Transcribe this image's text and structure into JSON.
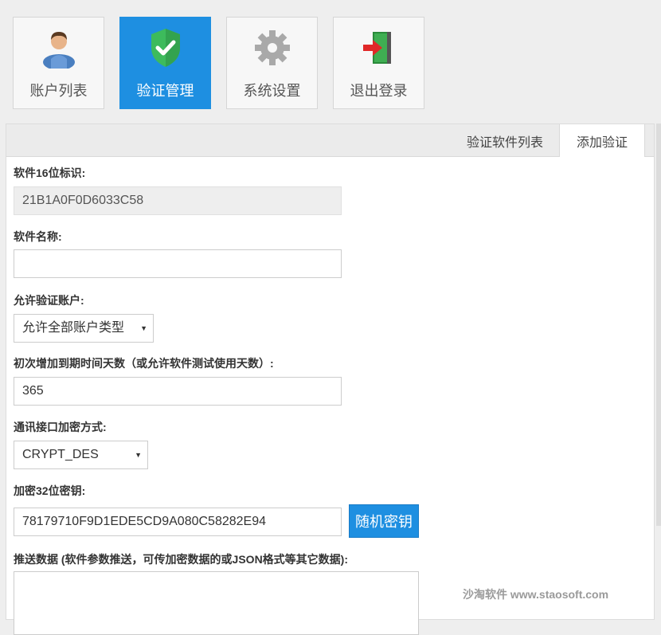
{
  "nav": {
    "items": [
      {
        "label": "账户列表",
        "icon": "user-icon",
        "active": false
      },
      {
        "label": "验证管理",
        "icon": "shield-check-icon",
        "active": true
      },
      {
        "label": "系统设置",
        "icon": "gear-icon",
        "active": false
      },
      {
        "label": "退出登录",
        "icon": "exit-door-icon",
        "active": false
      }
    ]
  },
  "tabs": [
    {
      "label": "验证软件列表",
      "active": false
    },
    {
      "label": "添加验证",
      "active": true
    }
  ],
  "form": {
    "software_id": {
      "label": "软件16位标识:",
      "value": "21B1A0F0D6033C58"
    },
    "software_name": {
      "label": "软件名称:",
      "value": ""
    },
    "allowed_accounts": {
      "label": "允许验证账户:",
      "value": "允许全部账户类型"
    },
    "initial_days": {
      "label": "初次增加到期时间天数（或允许软件测试使用天数）:",
      "value": "365"
    },
    "encryption": {
      "label": "通讯接口加密方式:",
      "value": "CRYPT_DES"
    },
    "key": {
      "label": "加密32位密钥:",
      "value": "78179710F9D1EDE5CD9A080C58282E94",
      "button": "随机密钥"
    },
    "push_data": {
      "label": "推送数据 (软件参数推送，可传加密数据的或JSON格式等其它数据):",
      "value": ""
    }
  },
  "watermark": "沙淘软件 www.staosoft.com",
  "colors": {
    "accent": "#1e8fe1",
    "shield": "#3dbb5c",
    "exit_door": "#2a8a3a",
    "exit_arrow": "#e02828"
  }
}
